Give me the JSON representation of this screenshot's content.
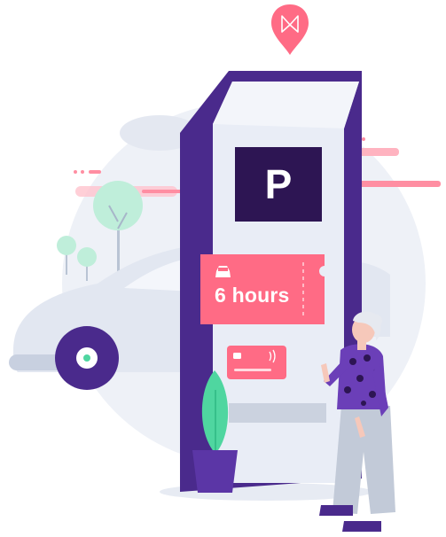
{
  "parking_sign": {
    "letter": "P"
  },
  "ticket": {
    "duration": "6 hours",
    "icon": "car-icon"
  },
  "card": {
    "icons": [
      "chip-icon",
      "contactless-icon"
    ]
  },
  "location_pin": {
    "icon": "bowtie-logo-icon"
  },
  "colors": {
    "kiosk_purple": "#4a2a8c",
    "sign_dark": "#2d1553",
    "ticket_pink": "#ff6b85",
    "background_circle": "#eef1f7",
    "plant_green": "#4fd6a0"
  }
}
